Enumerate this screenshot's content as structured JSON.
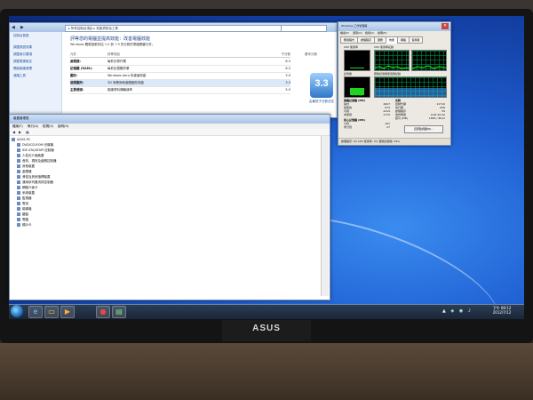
{
  "monitor": {
    "brand": "ASUS"
  },
  "performance_window": {
    "address": "▸ 所有控制台項目 ▸ 效能資訊及工具",
    "sidebar_items": [
      "控制台首頁",
      "調整視覺效果",
      "調整索引選項",
      "調整電源設定",
      "開啟磁碟清理",
      "進階工具"
    ],
    "heading": "評等您的電腦並提高效能：改善電腦效能",
    "subheading": "Windows 體驗指數評估 1.0 到 7.9 的分數的電腦關鍵元件。",
    "columns": [
      "元件",
      "評等項目",
      "子分數",
      "基本分數"
    ],
    "rows": [
      {
        "component": "處理器:",
        "item": "每秒計算作業",
        "score": "6.3"
      },
      {
        "component": "記憶體 (RAM):",
        "item": "每秒記憶體作業",
        "score": "6.3"
      },
      {
        "component": "圖形:",
        "item": "Windows Aero 的桌面效能",
        "score": "3.9"
      },
      {
        "component": "遊戲圖形:",
        "item": "3D 商業用和遊戲圖形效能",
        "score": "3.3"
      },
      {
        "component": "主要硬碟:",
        "item": "磁碟資料傳輸速率",
        "score": "5.9"
      }
    ],
    "base_score": "3.3",
    "base_caption": "由最低子分數決定"
  },
  "device_manager": {
    "title": "裝置管理員",
    "menu": [
      "檔案(F)",
      "執行(A)",
      "檢視(V)",
      "說明(H)"
    ],
    "tree": [
      "ASUS-PC",
      "DVD/CD-ROM 光碟機",
      "IDE ATA/ATAPI 控制器",
      "人性化介面裝置",
      "音效、視訊及遊戲控制器",
      "其他裝置",
      "處理器",
      "滑鼠及其他指標裝置",
      "通用序列匯流排控制器",
      "網路介面卡",
      "系統裝置",
      "監視器",
      "電池",
      "磁碟機",
      "鍵盤",
      "電腦",
      "顯示卡"
    ]
  },
  "task_manager": {
    "title": "Windows 工作管理員",
    "menu": [
      "檔案(F)",
      "選項(O)",
      "檢視(V)",
      "說明(H)"
    ],
    "tabs": [
      "應用程式",
      "處理程序",
      "服務",
      "效能",
      "網路",
      "使用者"
    ],
    "labels": {
      "cpu_usage": "CPU 使用率",
      "cpu_history": "CPU 使用率記錄",
      "memory": "記憶體",
      "memory_history": "實體記憶體使用量記錄"
    },
    "cpu_percent": 5,
    "memory_text": "1.55 GB",
    "physical_memory_label": "實體記憶體 (MB)",
    "physical_memory": [
      [
        "總計",
        "4007"
      ],
      [
        "快取的",
        "674"
      ],
      [
        "可用",
        "2419"
      ],
      [
        "未使用",
        "1770"
      ]
    ],
    "system_label": "系統",
    "system": [
      [
        "控制代碼",
        "11710"
      ],
      [
        "執行緒",
        "646"
      ],
      [
        "處理程序",
        "59"
      ],
      [
        "運作時間",
        "0:00:25:20"
      ],
      [
        "認可 (MB)",
        "1856 / 8012"
      ]
    ],
    "kernel_label": "核心記憶體 (MB)",
    "kernel": [
      [
        "分頁",
        "161"
      ],
      [
        "非分頁",
        "27"
      ]
    ],
    "resource_button": "資源監視器(R)...",
    "status": "處理程序: 59   CPU 使用率: 0%   實體記憶體: 39%"
  },
  "taskbar": {
    "icons": [
      "ie-icon",
      "folder-icon",
      "media-player-icon",
      "chrome-icon",
      "taskmgr-icon"
    ],
    "clock_time": "下午 08:12",
    "clock_date": "2012/7/12"
  }
}
